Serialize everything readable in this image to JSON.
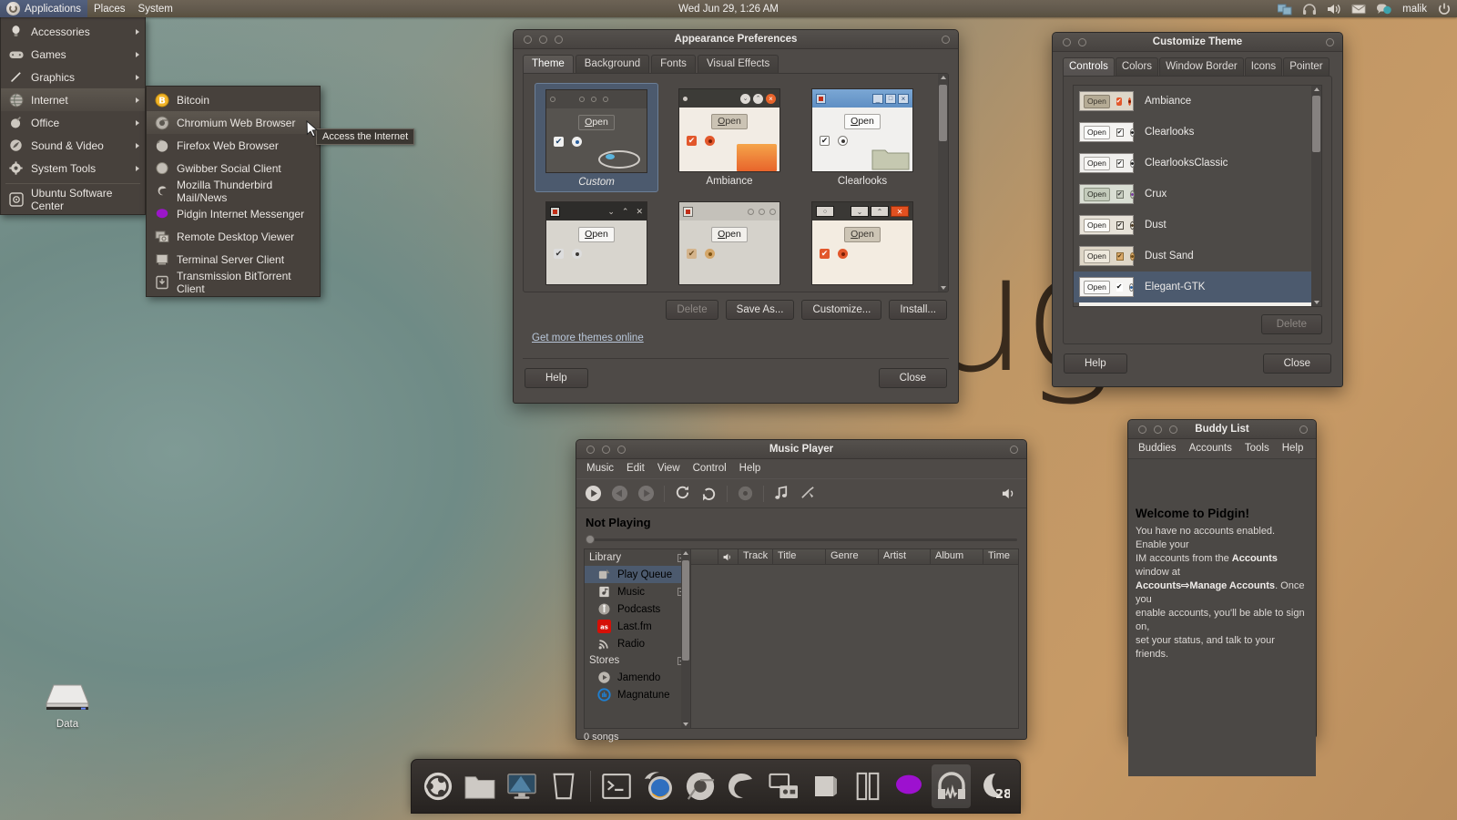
{
  "panel": {
    "menus": [
      "Applications",
      "Places",
      "System"
    ],
    "clock": "Wed Jun 29,  1:26 AM",
    "tray": [
      "workspace-switcher-icon",
      "headphones-icon",
      "volume-icon",
      "mail-icon",
      "chat-icon"
    ],
    "user": "malik",
    "power_icon": "power-icon"
  },
  "app_menu": {
    "items": [
      {
        "label": "Accessories",
        "icon": "lightbulb-icon",
        "submenu": true
      },
      {
        "label": "Games",
        "icon": "gamepad-icon",
        "submenu": true
      },
      {
        "label": "Graphics",
        "icon": "pencil-icon",
        "submenu": true
      },
      {
        "label": "Internet",
        "icon": "globe-icon",
        "submenu": true,
        "selected": true
      },
      {
        "label": "Office",
        "icon": "briefcase-icon",
        "submenu": true
      },
      {
        "label": "Sound & Video",
        "icon": "speaker-icon",
        "submenu": true
      },
      {
        "label": "System Tools",
        "icon": "gear-icon",
        "submenu": true
      },
      {
        "label": "Ubuntu Software Center",
        "icon": "software-center-icon",
        "submenu": false
      }
    ]
  },
  "sub_menu": {
    "items": [
      {
        "label": "Bitcoin",
        "icon": "bitcoin-icon"
      },
      {
        "label": "Chromium Web Browser",
        "icon": "chromium-icon",
        "selected": true
      },
      {
        "label": "Firefox Web Browser",
        "icon": "firefox-icon"
      },
      {
        "label": "Gwibber Social Client",
        "icon": "gwibber-icon"
      },
      {
        "label": "Mozilla Thunderbird Mail/News",
        "icon": "thunderbird-icon"
      },
      {
        "label": "Pidgin Internet Messenger",
        "icon": "pidgin-icon"
      },
      {
        "label": "Remote Desktop Viewer",
        "icon": "remote-desktop-icon"
      },
      {
        "label": "Terminal Server Client",
        "icon": "terminal-server-icon"
      },
      {
        "label": "Transmission BitTorrent Client",
        "icon": "transmission-icon"
      }
    ]
  },
  "tooltip": {
    "text": "Access the Internet"
  },
  "desktop": {
    "icon_label": "Data",
    "icon": "hard-drive-icon",
    "wallpaper_text": "ugh"
  },
  "appearance": {
    "title": "Appearance Preferences",
    "tabs": [
      "Theme",
      "Background",
      "Fonts",
      "Visual Effects"
    ],
    "active_tab": "Theme",
    "themes": [
      {
        "name": "Custom",
        "selected": true,
        "style": "custom"
      },
      {
        "name": "Ambiance",
        "selected": false,
        "style": "ambiance"
      },
      {
        "name": "Clearlooks",
        "selected": false,
        "style": "clearlooks"
      },
      {
        "name": "",
        "selected": false,
        "style": "dark"
      },
      {
        "name": "",
        "selected": false,
        "style": "light"
      },
      {
        "name": "",
        "selected": false,
        "style": "radiance"
      }
    ],
    "buttons": {
      "delete": "Delete",
      "save_as": "Save As...",
      "customize": "Customize...",
      "install": "Install...",
      "help": "Help",
      "close": "Close"
    },
    "link": "Get more themes online",
    "open_label": "Open"
  },
  "customize": {
    "title": "Customize Theme",
    "tabs": [
      "Controls",
      "Colors",
      "Window Border",
      "Icons",
      "Pointer"
    ],
    "active_tab": "Controls",
    "open_label": "Open",
    "rows": [
      {
        "label": "Ambiance",
        "selected": false,
        "variant": "ambiance"
      },
      {
        "label": "Clearlooks",
        "selected": false,
        "variant": "clearlooks"
      },
      {
        "label": "ClearlooksClassic",
        "selected": false,
        "variant": "clearlooks"
      },
      {
        "label": "Crux",
        "selected": false,
        "variant": "crux"
      },
      {
        "label": "Dust",
        "selected": false,
        "variant": "dust"
      },
      {
        "label": "Dust Sand",
        "selected": false,
        "variant": "dustsand"
      },
      {
        "label": "Elegant-GTK",
        "selected": true,
        "variant": "elegant"
      }
    ],
    "buttons": {
      "delete": "Delete",
      "help": "Help",
      "close": "Close"
    }
  },
  "music_player": {
    "title": "Music Player",
    "menus": [
      "Music",
      "Edit",
      "View",
      "Control",
      "Help"
    ],
    "toolbar_icons": [
      "play-icon",
      "previous-icon",
      "next-icon",
      "repeat-icon",
      "shuffle-icon",
      "burn-disc-icon",
      "visualization-icon",
      "party-mode-icon",
      "volume-icon"
    ],
    "now_playing": "Not Playing",
    "sidebar": [
      {
        "group": "Library",
        "expander": "collapse"
      },
      {
        "label": "Play Queue",
        "icon": "play-queue-icon",
        "selected": true
      },
      {
        "label": "Music",
        "icon": "music-library-icon",
        "expander": "expand"
      },
      {
        "label": "Podcasts",
        "icon": "podcast-icon"
      },
      {
        "label": "Last.fm",
        "icon": "lastfm-icon"
      },
      {
        "label": "Radio",
        "icon": "radio-icon"
      },
      {
        "group": "Stores",
        "expander": "collapse"
      },
      {
        "label": "Jamendo",
        "icon": "jamendo-icon"
      },
      {
        "label": "Magnatune",
        "icon": "magnatune-icon"
      }
    ],
    "columns": [
      "Track",
      "Title",
      "Genre",
      "Artist",
      "Album",
      "Time"
    ],
    "rows": [],
    "status": "0 songs"
  },
  "pidgin": {
    "title": "Buddy List",
    "menus": [
      "Buddies",
      "Accounts",
      "Tools",
      "Help"
    ],
    "welcome": "Welcome to Pidgin!",
    "body_line1": "You have no accounts enabled. Enable your",
    "body_line2_a": "IM accounts from the ",
    "body_line2_b": "Accounts",
    "body_line2_c": " window at",
    "body_line3_a": "Accounts⇨Manage Accounts",
    "body_line3_b": ". Once you",
    "body_line4": "enable accounts, you'll be able to sign on,",
    "body_line5": "set your status, and talk to your friends."
  },
  "dock": {
    "items": [
      {
        "name": "ubuntu-menu-icon"
      },
      {
        "name": "files-icon"
      },
      {
        "name": "display-icon"
      },
      {
        "name": "trash-icon"
      },
      {
        "sep": true
      },
      {
        "name": "terminal-icon"
      },
      {
        "name": "firefox-icon"
      },
      {
        "name": "chromium-icon"
      },
      {
        "name": "thunderbird-icon"
      },
      {
        "name": "remote-desktop-icon"
      },
      {
        "name": "window-icon"
      },
      {
        "name": "book-icon"
      },
      {
        "name": "pidgin-icon"
      },
      {
        "name": "music-player-icon",
        "active": true
      },
      {
        "name": "weather-icon",
        "label": "28°"
      }
    ]
  },
  "colors": {
    "panel_bg": "#635a4e",
    "window_bg": "#4e4a47",
    "selection": "#4c5a6e",
    "accent_orange": "#dd4814",
    "text": "#e8e6e4"
  }
}
